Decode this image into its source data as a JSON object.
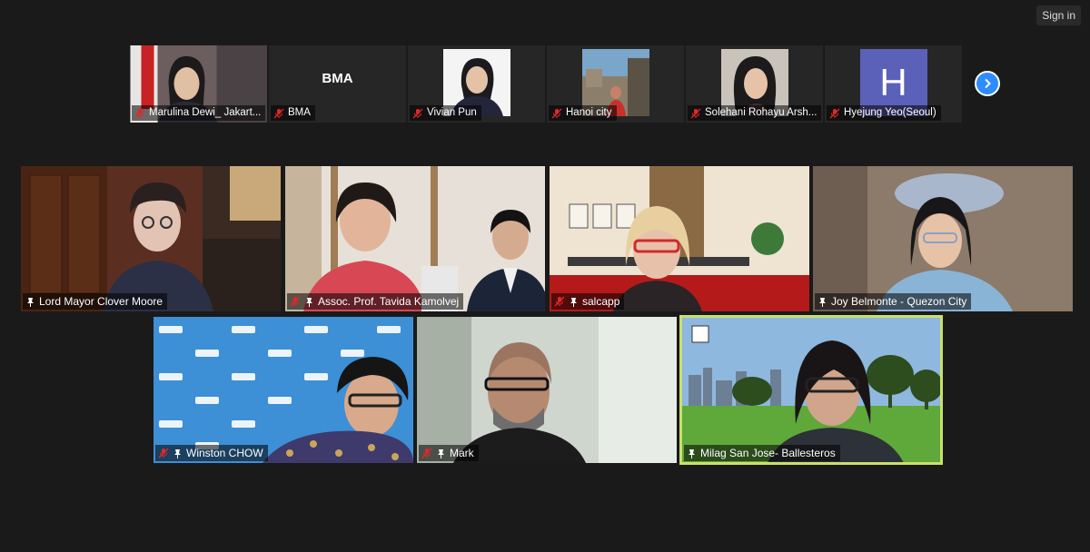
{
  "header": {
    "signin_label": "Sign in"
  },
  "thumbnails": [
    {
      "name": "Marulina Dewi_ Jakart...",
      "type": "video",
      "muted": true
    },
    {
      "name": "BMA",
      "type": "text",
      "display": "BMA",
      "muted": true
    },
    {
      "name": "Vivian Pun",
      "type": "photo",
      "muted": true
    },
    {
      "name": "Hanoi city",
      "type": "video",
      "muted": true
    },
    {
      "name": "Solehani Rohayu Arsh...",
      "type": "video",
      "muted": true
    },
    {
      "name": "Hyejung Yeo(Seoul)",
      "type": "initial",
      "display": "H",
      "muted": true
    }
  ],
  "gallery": [
    {
      "name": "Lord Mayor Clover Moore",
      "muted": false,
      "pinned_icon": true
    },
    {
      "name": "Assoc. Prof. Tavida Kamolvej",
      "muted": true,
      "pinned_icon": true
    },
    {
      "name": "salcapp",
      "muted": true,
      "pinned_icon": true
    },
    {
      "name": "Joy Belmonte - Quezon City",
      "muted": false,
      "pinned_icon": true
    },
    {
      "name": "Winston CHOW",
      "muted": true,
      "pinned_icon": true
    },
    {
      "name": "Mark",
      "muted": true,
      "pinned_icon": true
    },
    {
      "name": "Milag San Jose- Ballesteros",
      "muted": false,
      "pinned_icon": true,
      "active_speaker": true
    }
  ],
  "colors": {
    "accent": "#2d8cff",
    "active_speaker_border": "#c9e06b",
    "muted_icon": "#e02828",
    "avatar_bg": "#5b60b8"
  }
}
